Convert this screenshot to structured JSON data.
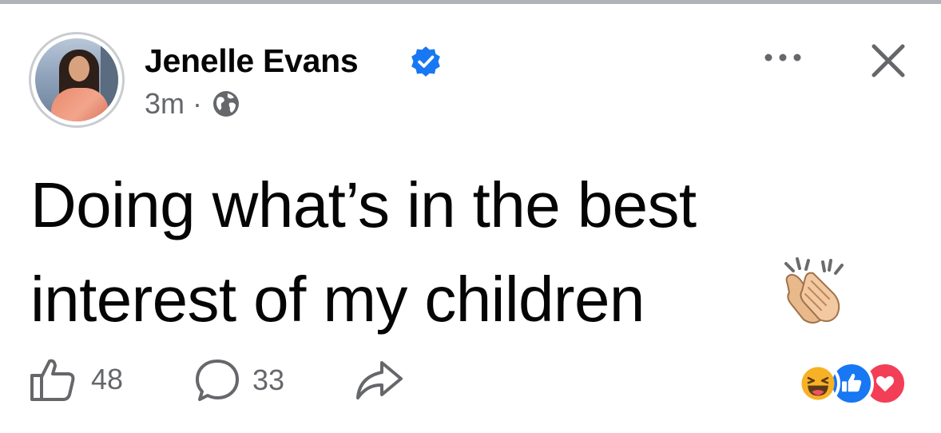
{
  "post": {
    "author": "Jenelle Evans",
    "timestamp": "3m",
    "separator": "·",
    "privacy_icon": "globe-icon",
    "verified_icon": "verified-badge-icon",
    "text_line1": "Doing what’s in the best",
    "text_line2": "interest of my children",
    "emoji": "clapping-hands-emoji"
  },
  "header_actions": {
    "more_icon": "more-options-icon",
    "close_icon": "close-icon"
  },
  "footer": {
    "like_count": "48",
    "comment_count": "33",
    "share_icon": "share-icon",
    "reactions": [
      "haha",
      "like",
      "love"
    ]
  },
  "colors": {
    "accent_blue": "#1877f2",
    "secondary_text": "#65676b",
    "primary_text": "#050505",
    "love_red": "#f33e58",
    "haha_yellow": "#f7b125"
  }
}
